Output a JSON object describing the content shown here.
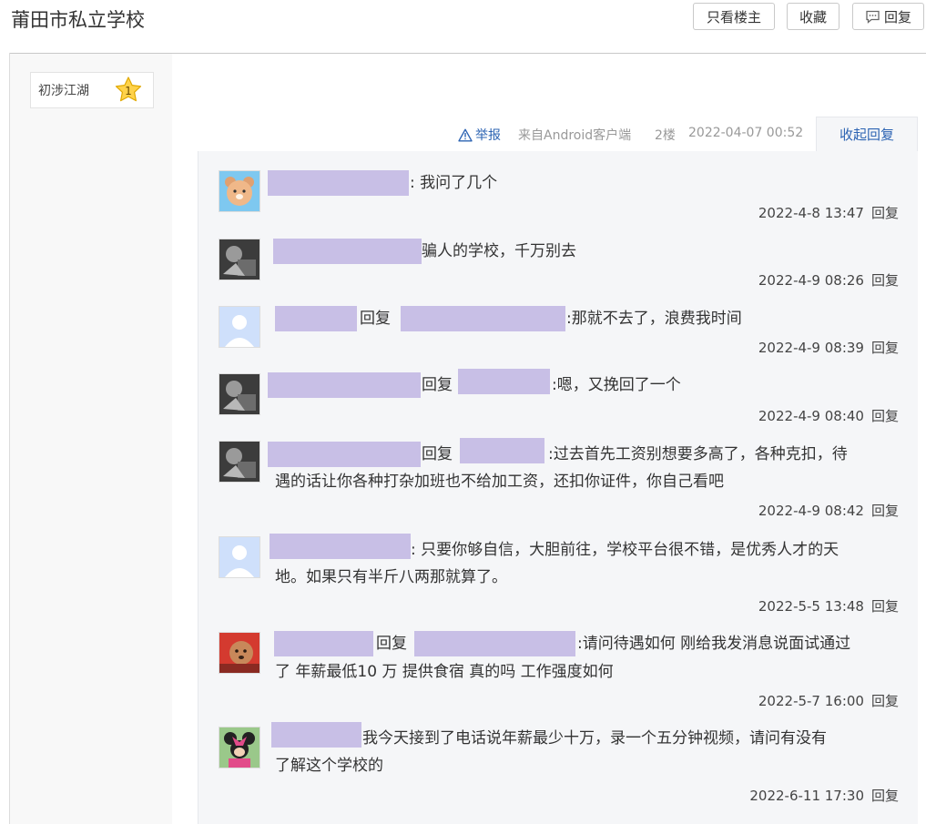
{
  "header": {
    "title": "莆田市私立学校",
    "only_author_label": "只看楼主",
    "favorite_label": "收藏",
    "reply_label": "回复"
  },
  "sidebar": {
    "rank_name": "初涉江湖",
    "rank_level": "1"
  },
  "post_meta": {
    "report_label": "举报",
    "source": "来自Android客户端",
    "floor": "2楼",
    "datetime": "2022-04-07 00:52",
    "collapse_label": "收起回复"
  },
  "replies": [
    {
      "avatar": "bear-avatar",
      "connector": "",
      "text": ": 我问了几个",
      "time": "2022-4-8 13:47",
      "reply": "回复"
    },
    {
      "avatar": "bw-photo-avatar",
      "connector": "",
      "text": "骗人的学校，千万别去",
      "time": "2022-4-9 08:26",
      "reply": "回复"
    },
    {
      "avatar": "default-avatar",
      "connector": "回复",
      "text": ":那就不去了，浪费我时间",
      "time": "2022-4-9 08:39",
      "reply": "回复"
    },
    {
      "avatar": "bw-photo-avatar",
      "connector": "回复",
      "text": ":嗯，又挽回了一个",
      "time": "2022-4-9 08:40",
      "reply": "回复"
    },
    {
      "avatar": "bw-photo-avatar",
      "connector": "回复",
      "text": ":过去首先工资别想要多高了，各种克扣，待",
      "text2": "遇的话让你各种打杂加班也不给加工资，还扣你证件，你自己看吧",
      "time": "2022-4-9 08:42",
      "reply": "回复"
    },
    {
      "avatar": "default-avatar",
      "connector": "",
      "text": ": 只要你够自信，大胆前往，学校平台很不错，是优秀人才的天",
      "text2": "地。如果只有半斤八两那就算了。",
      "time": "2022-5-5 13:48",
      "reply": "回复"
    },
    {
      "avatar": "dog-avatar",
      "connector": "回复",
      "text": ":请问待遇如何 刚给我发消息说面试通过",
      "text2": "了 年薪最低10 万 提供食宿 真的吗 工作强度如何",
      "time": "2022-5-7 16:00",
      "reply": "回复"
    },
    {
      "avatar": "minnie-avatar",
      "connector": "",
      "text": "我今天接到了电话说年薪最少十万，录一个五分钟视频，请问有没有",
      "text2": "了解这个学校的",
      "time": "2022-6-11 17:30",
      "reply": "回复"
    }
  ]
}
